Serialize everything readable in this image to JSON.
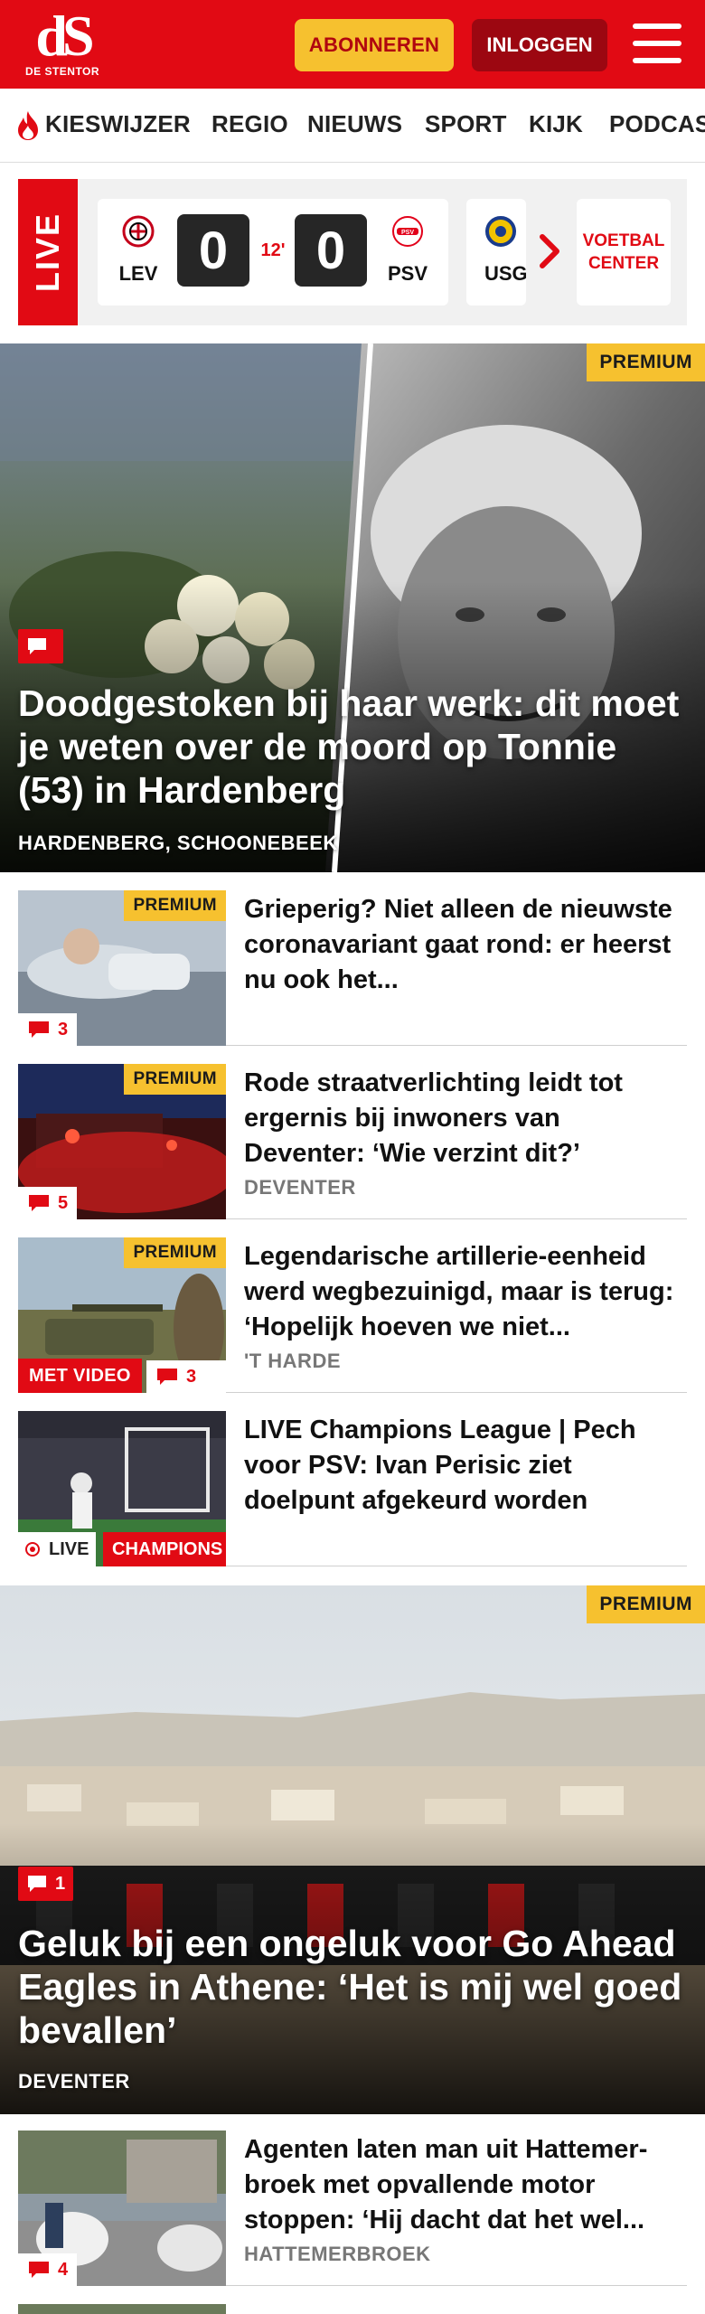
{
  "header": {
    "logo_mark": "dS",
    "logo_text": "DE STENTOR",
    "subscribe_label": "ABONNEREN",
    "login_label": "INLOGGEN",
    "brand_color": "#e10a14"
  },
  "nav": {
    "items": [
      {
        "label": "KIESWIJZER",
        "icon": "flame-icon"
      },
      {
        "label": "REGIO"
      },
      {
        "label": "NIEUWS"
      },
      {
        "label": "SPORT"
      },
      {
        "label": "KIJK"
      },
      {
        "label": "PODCAS"
      }
    ]
  },
  "live": {
    "tab_label": "LIVE",
    "match": {
      "home": "LEV",
      "home_score": "0",
      "minute": "12'",
      "away_score": "0",
      "away": "PSV"
    },
    "next_match_team": "USG",
    "voetbal_center_label": "VOETBAL CENTER"
  },
  "hero1": {
    "badge": "PREMIUM",
    "comments": "",
    "title": "Doodgestoken bij haar werk: dit moet je weten over de moord op Tonnie (53) in Hardenberg",
    "location": "HARDENBERG, SCHOONEBEEK"
  },
  "articles": [
    {
      "badge": "PREMIUM",
      "comments": "3",
      "title": "Grieperig? Niet alleen de nieuwste coronavariant gaat rond: er heerst nu ook het...",
      "location": ""
    },
    {
      "badge": "PREMIUM",
      "comments": "5",
      "title": "Rode straatverlichting leidt tot ergernis bij inwoners van Deventer: ‘Wie verzint dit?’",
      "location": "DEVENTER"
    },
    {
      "badge": "PREMIUM",
      "video_label": "MET VIDEO",
      "comments": "3",
      "title": "Legendarische artillerie-eenheid werd wegbezuinigd, maar is terug: ‘Hopelijk hoeven we niet...",
      "location": "'T HARDE"
    },
    {
      "live_label": "LIVE",
      "category_label": "CHAMPIONS LEAGUE",
      "title": "LIVE Champions League | Pech voor PSV: Ivan Perisic ziet doelpunt afgekeurd worden",
      "location": ""
    }
  ],
  "hero2": {
    "badge": "PREMIUM",
    "comments": "1",
    "title": "Geluk bij een ongeluk voor Go Ahead Eagles in Athene: ‘Het is mij wel goed bevallen’",
    "location": "DEVENTER"
  },
  "article_after": {
    "comments": "4",
    "title": "Agenten laten man uit Hattemer­broek met opvallende motor stoppen: ‘Hij dacht dat het wel...",
    "location": "HATTEMERBROEK"
  }
}
